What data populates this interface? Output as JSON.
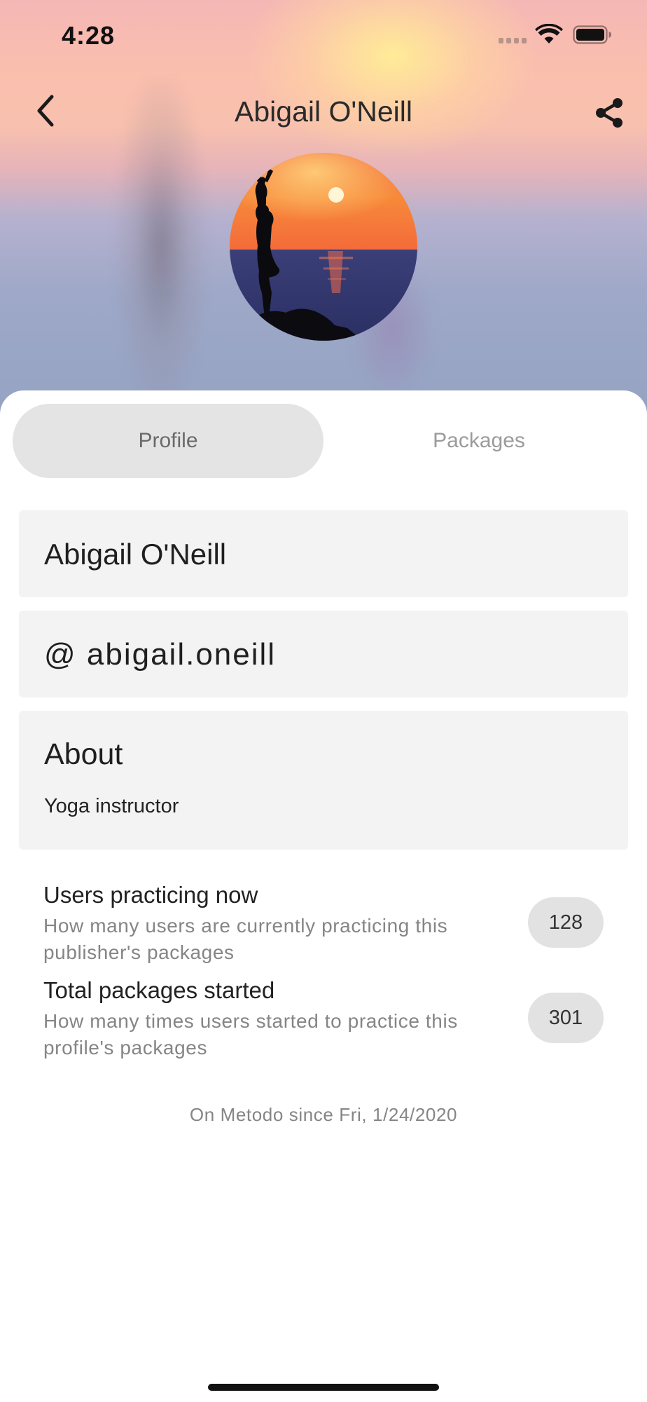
{
  "status_bar": {
    "time": "4:28"
  },
  "header": {
    "title": "Abigail O'Neill",
    "back_icon": "chevron-left-icon",
    "share_icon": "share-icon"
  },
  "tabs": {
    "items": [
      {
        "label": "Profile",
        "active": true
      },
      {
        "label": "Packages",
        "active": false
      }
    ]
  },
  "profile": {
    "name": "Abigail O'Neill",
    "username": "@ abigail.oneill",
    "about": {
      "title": "About",
      "text": "Yoga instructor"
    },
    "stats": [
      {
        "title": "Users practicing now",
        "description": "How many users are currently practicing this publisher's packages",
        "value": "128"
      },
      {
        "title": "Total packages started",
        "description": "How many times users started to practice this profile's packages",
        "value": "301"
      }
    ],
    "member_since": "On Metodo since Fri, 1/24/2020"
  },
  "colors": {
    "segment_active_bg": "#e4e4e4",
    "card_bg": "#f3f3f3",
    "badge_bg": "#e2e2e2",
    "muted_text": "#858585"
  }
}
